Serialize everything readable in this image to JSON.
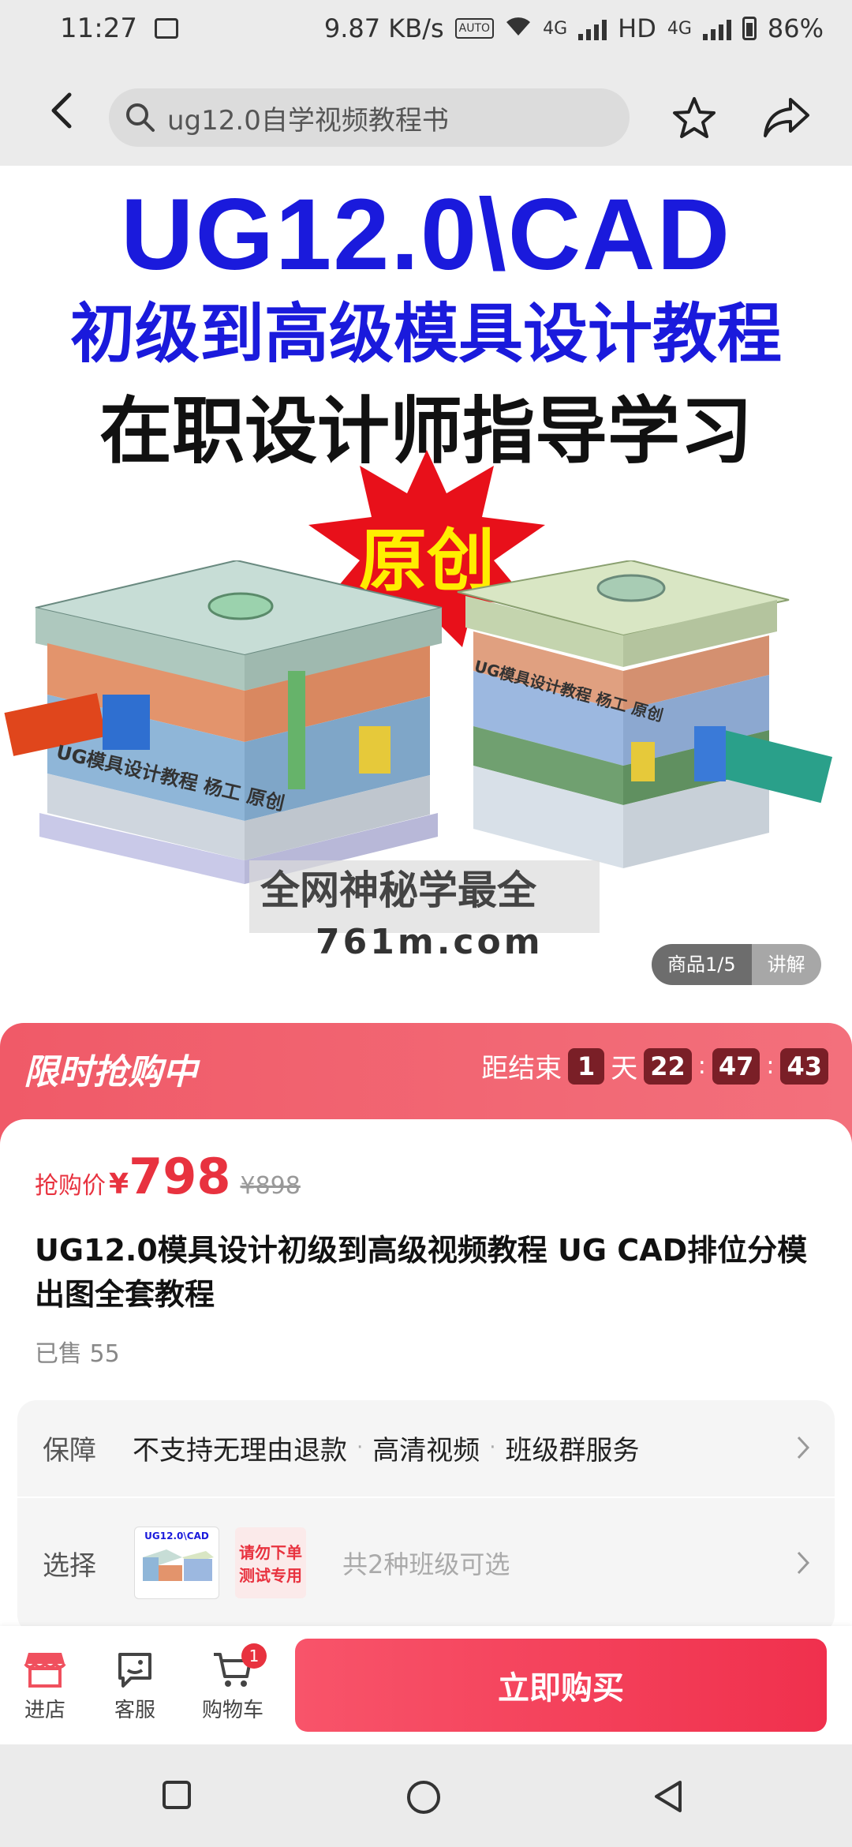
{
  "status_bar": {
    "time": "11:27",
    "speed": "9.87 KB/s",
    "auto_tag": "AUTO",
    "net1": "4G",
    "sim1_tag": "1",
    "hd": "HD",
    "net2": "4G",
    "battery": "86%"
  },
  "nav": {
    "search_text": "ug12.0自学视频教程书"
  },
  "hero": {
    "line1": "UG12.0\\CAD",
    "line2": "初级到高级模具设计教程",
    "line3": "在职设计师指导学习",
    "burst": "原创",
    "mold_label_left": "UG模具设计教程 杨工 原创",
    "mold_label_right": "UG模具设计教程 杨工 原创",
    "watermark_line1": "全网神秘学最全",
    "watermark_line2": "761m.com",
    "counter": "商品1/5",
    "explain": "讲解"
  },
  "flash_sale": {
    "title": "限时抢购中",
    "ends_label": "距结束",
    "days": "1",
    "day_unit": "天",
    "hours": "22",
    "minutes": "47",
    "seconds": "43"
  },
  "product": {
    "price_label": "抢购价",
    "currency": "¥",
    "price": "798",
    "original_price": "¥898",
    "title": "UG12.0模具设计初级到高级视频教程 UG CAD排位分模出图全套教程",
    "sold": "已售 55"
  },
  "services": {
    "guarantee_label": "保障",
    "guarantee_items": [
      "不支持无理由退款",
      "高清视频",
      "班级群服务"
    ],
    "choose_label": "选择",
    "thumb_title": "UG12.0\\CAD",
    "thumb2_line1": "请勿下单",
    "thumb2_line2": "测试专用",
    "choose_hint": "共2种班级可选"
  },
  "bottom_bar": {
    "store": "进店",
    "service": "客服",
    "cart": "购物车",
    "cart_count": "1",
    "buy": "立即购买"
  },
  "colors": {
    "accent": "#e8323f",
    "flash_bg": "#f05a68",
    "title_blue": "#1a1adc"
  }
}
